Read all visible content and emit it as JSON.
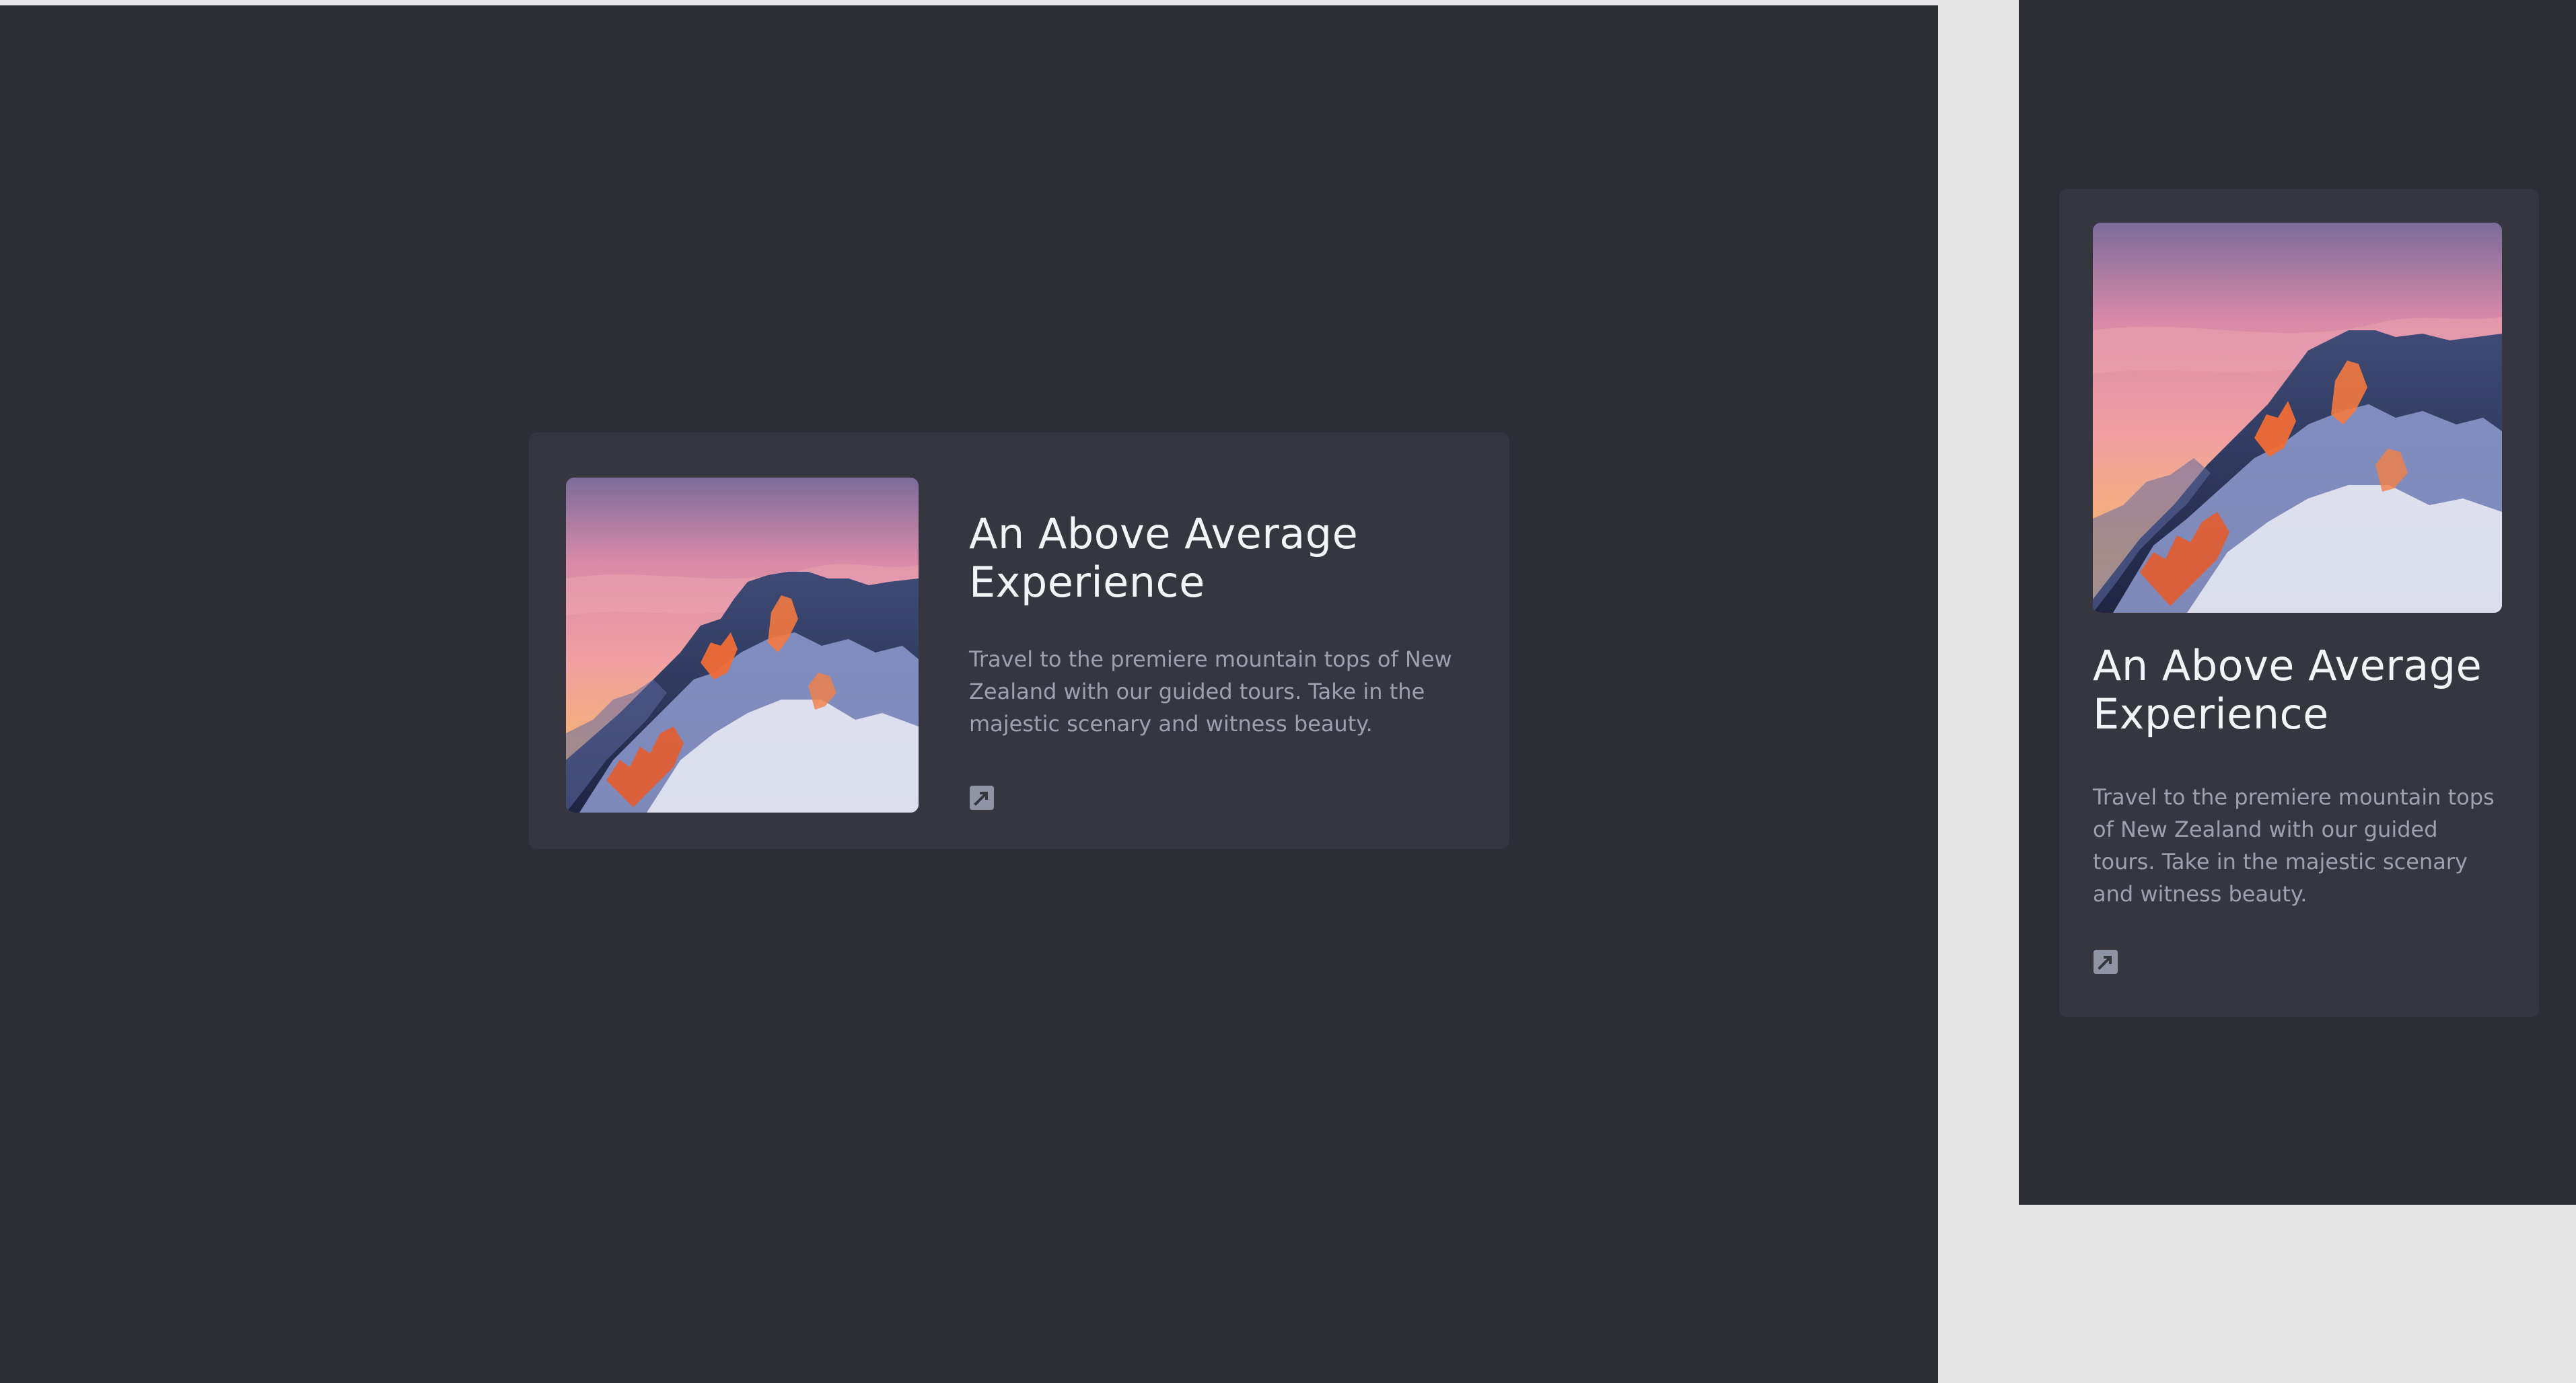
{
  "cards": [
    {
      "title": "An Above Average Experience",
      "description": "Travel to the premiere mountain tops of New Zealand with our guided tours. Take in the majestic scenary and witness beauty.",
      "image_alt": "Snow-covered mountain peak at sunset",
      "link_icon": "external-link-icon"
    },
    {
      "title": "An Above Average Experience",
      "description": "Travel to the premiere mountain tops of New Zealand with our guided tours. Take in the majestic scenary and witness beauty.",
      "image_alt": "Snow-covered mountain peak at sunset",
      "link_icon": "external-link-icon"
    }
  ],
  "colors": {
    "page_background": "#e6e6e7",
    "frame_background": "#2d2d36",
    "card_background": "#363641",
    "title_color": "#f3f4f7",
    "description_color": "#9ea1ad",
    "icon_color": "#8f93a3"
  }
}
